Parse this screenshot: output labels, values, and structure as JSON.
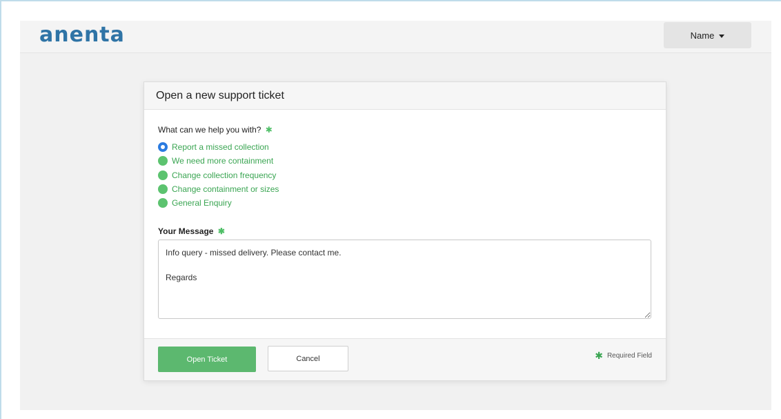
{
  "header": {
    "logo": "anenta",
    "user_menu_label": "Name"
  },
  "modal": {
    "title": "Open a new support ticket",
    "question": "What can we help you with?",
    "required_marker": "✱",
    "options": [
      {
        "label": "Report a missed collection",
        "selected": true
      },
      {
        "label": "We need more containment",
        "selected": false
      },
      {
        "label": "Change collection frequency",
        "selected": false
      },
      {
        "label": "Change containment or sizes",
        "selected": false
      },
      {
        "label": "General Enquiry",
        "selected": false
      }
    ],
    "message_label": "Your Message",
    "message_value": "Info query - missed delivery. Please contact me.\n\nRegards",
    "open_button": "Open Ticket",
    "cancel_button": "Cancel",
    "required_note": "Required Field"
  },
  "colors": {
    "accent_green": "#5cb86f",
    "radio_selected": "#2b7be0",
    "logo_blue": "#2f74a6"
  }
}
